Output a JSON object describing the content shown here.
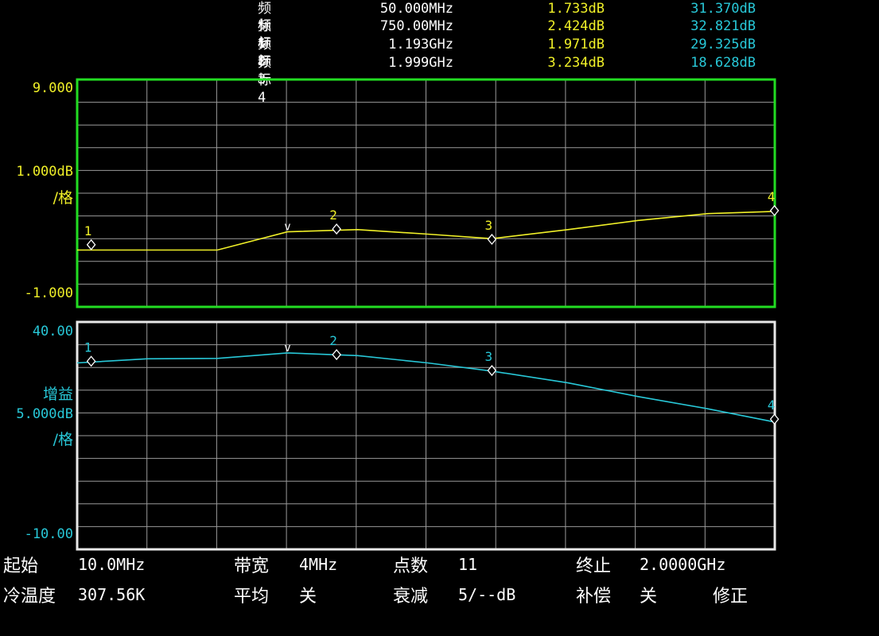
{
  "markers": [
    {
      "name": "频标1",
      "freq": "50.000MHz",
      "v1": "1.733dB",
      "v2": "31.370dB"
    },
    {
      "name": "频标2",
      "freq": "750.00MHz",
      "v1": "2.424dB",
      "v2": "32.821dB"
    },
    {
      "name": "频标3",
      "freq": "1.193GHz",
      "v1": "1.971dB",
      "v2": "29.325dB"
    },
    {
      "name": "频标4",
      "freq": "1.999GHz",
      "v1": "3.234dB",
      "v2": "18.628dB"
    }
  ],
  "colors": {
    "trace1": "#f0f028",
    "trace2": "#28c8d8",
    "frame1": "#22dd22",
    "frame2": "#e8e8e8",
    "grid": "#9a9a9a"
  },
  "panel1": {
    "top_label": "9.000",
    "scale_label": "1.000dB",
    "scale_unit": "/格",
    "bottom_label": "-1.000"
  },
  "panel2": {
    "top_label": "40.00",
    "param_label": "增益",
    "scale_label": "5.000dB",
    "scale_unit": "/格",
    "bottom_label": "-10.00"
  },
  "footer": {
    "start_label": "起始",
    "start_value": "10.0MHz",
    "bw_label": "带宽",
    "bw_value": "4MHz",
    "points_label": "点数",
    "points_value": "11",
    "stop_label": "终止",
    "stop_value": "2.0000GHz",
    "temp_label": "冷温度",
    "temp_value": "307.56K",
    "avg_label": "平均",
    "avg_value": "关",
    "atten_label": "衰减",
    "atten_value": "5/--dB",
    "comp_label": "补偿",
    "comp_value": "关",
    "correct_label": "修正"
  },
  "chart_data": [
    {
      "type": "line",
      "series": [
        {
          "values": [
            [
              10,
              1.5
            ],
            [
              210,
              1.5
            ],
            [
              410,
              1.5
            ],
            [
              610,
              2.3
            ],
            [
              810,
              2.4
            ],
            [
              1010,
              2.2
            ],
            [
              1193,
              2.0
            ],
            [
              1410,
              2.4
            ],
            [
              1610,
              2.8
            ],
            [
              1810,
              3.1
            ],
            [
              1999,
              3.2
            ]
          ]
        }
      ],
      "xlim": [
        10,
        2000
      ],
      "ylim": [
        -1.0,
        9.0
      ],
      "x_unit": "MHz",
      "markers": [
        {
          "label": "1",
          "x": 50,
          "y": 1.733
        },
        {
          "label": "2",
          "x": 750,
          "y": 2.424
        },
        {
          "label": "3",
          "x": 1193,
          "y": 1.971
        },
        {
          "label": "4",
          "x": 1999,
          "y": 3.234
        }
      ],
      "reference_marker": {
        "label": "v",
        "x": 610,
        "y": 2.3
      },
      "grid": true
    },
    {
      "type": "line",
      "series": [
        {
          "values": [
            [
              10,
              31.0
            ],
            [
              210,
              31.9
            ],
            [
              410,
              32.0
            ],
            [
              610,
              33.2
            ],
            [
              810,
              32.6
            ],
            [
              1010,
              31.0
            ],
            [
              1193,
              29.2
            ],
            [
              1410,
              26.6
            ],
            [
              1610,
              23.6
            ],
            [
              1810,
              20.9
            ],
            [
              1999,
              18.0
            ]
          ]
        }
      ],
      "xlim": [
        10,
        2000
      ],
      "ylim": [
        -10.0,
        40.0
      ],
      "x_unit": "MHz",
      "markers": [
        {
          "label": "1",
          "x": 50,
          "y": 31.37
        },
        {
          "label": "2",
          "x": 750,
          "y": 32.821
        },
        {
          "label": "3",
          "x": 1193,
          "y": 29.325
        },
        {
          "label": "4",
          "x": 1999,
          "y": 18.628
        }
      ],
      "reference_marker": {
        "label": "v",
        "x": 610,
        "y": 33.2
      },
      "grid": true
    }
  ]
}
